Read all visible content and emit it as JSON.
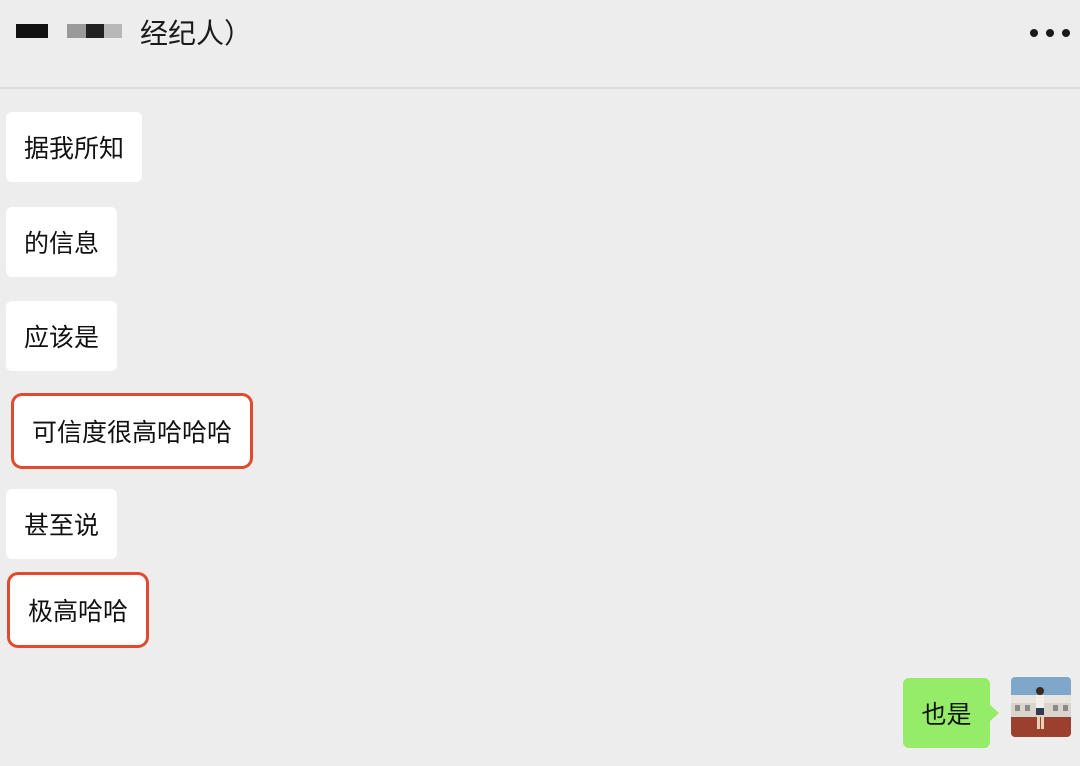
{
  "header": {
    "title": "经纪人）"
  },
  "messages": [
    {
      "text": "据我所知",
      "highlighted": false
    },
    {
      "text": "的信息",
      "highlighted": false
    },
    {
      "text": "应该是",
      "highlighted": false
    },
    {
      "text": "可信度很高哈哈哈",
      "highlighted": true
    },
    {
      "text": "甚至说",
      "highlighted": false
    },
    {
      "text": "极高哈哈",
      "highlighted": true
    }
  ],
  "reply": {
    "text": "也是"
  },
  "colors": {
    "background": "#ededed",
    "received_bubble": "#ffffff",
    "sent_bubble": "#95ec69",
    "highlight": "#e24a2f"
  },
  "icons": {
    "more": "more-dots-icon"
  }
}
